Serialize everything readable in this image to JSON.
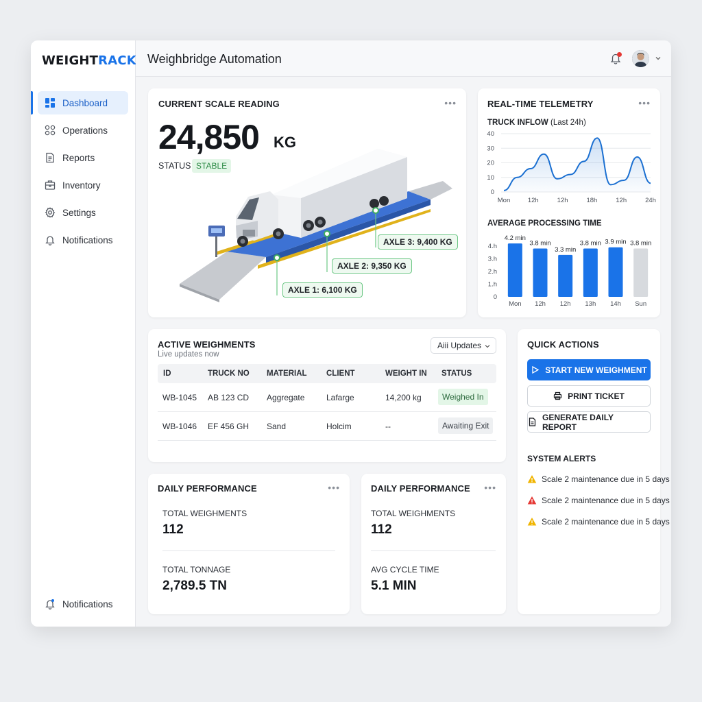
{
  "brand": {
    "part1": "WEIGHT",
    "part2": "RACK"
  },
  "header": {
    "title": "Weighbridge Automation"
  },
  "sidebar": {
    "items": [
      {
        "label": "Dashboard",
        "icon": "dashboard-icon",
        "active": true
      },
      {
        "label": "Operations",
        "icon": "operations-icon"
      },
      {
        "label": "Reports",
        "icon": "reports-icon"
      },
      {
        "label": "Inventory",
        "icon": "inventory-icon"
      },
      {
        "label": "Settings",
        "icon": "gear-icon"
      },
      {
        "label": "Notifications",
        "icon": "bell-icon"
      }
    ],
    "bottom": {
      "label": "Notifications"
    }
  },
  "scale": {
    "title": "CURRENT SCALE READING",
    "weight": "24,850",
    "unit": "KG",
    "status_label": "STATUS",
    "status": "STABLE",
    "axles": [
      "AXLE 1: 6,100 KG",
      "AXLE 2: 9,350 KG",
      "AXLE 3: 9,400 KG"
    ]
  },
  "telemetry": {
    "title": "REAL-TIME TELEMETRY",
    "inflow_title": "TRUCK INFLOW",
    "inflow_sub": "(Last 24h)",
    "processing_title": "AVERAGE PROCESSING TIME"
  },
  "chart_data": [
    {
      "type": "line",
      "title": "TRUCK INFLOW (Last 24h)",
      "x_labels": [
        "Mon",
        "12h",
        "12h",
        "18h",
        "12h",
        "24h"
      ],
      "y_ticks": [
        0,
        10,
        20,
        30,
        40
      ],
      "ylim": [
        0,
        40
      ],
      "values": [
        1,
        10,
        16,
        26,
        9,
        12,
        21,
        37,
        5,
        8,
        24,
        6
      ],
      "grid": true,
      "color": "#1a6fd1"
    },
    {
      "type": "bar",
      "title": "AVERAGE PROCESSING TIME",
      "categories": [
        "Mon",
        "12h",
        "12h",
        "13h",
        "14h",
        "Sun"
      ],
      "values": [
        4.2,
        3.8,
        3.3,
        3.8,
        3.9,
        3.8
      ],
      "data_labels": [
        "4.2 min",
        "3.8 min",
        "3.3 min",
        "3.8 min",
        "3.9 min",
        "3.8 min"
      ],
      "y_ticks": [
        "0",
        "1.h",
        "2.h",
        "3.h",
        "4.h"
      ],
      "ylim": [
        0,
        4.8
      ],
      "colors": [
        "#1a73e8",
        "#1a73e8",
        "#1a73e8",
        "#1a73e8",
        "#1a73e8",
        "#d7dade"
      ]
    }
  ],
  "weighments": {
    "title": "ACTIVE WEIGHMENTS",
    "subtitle": "Live updates now",
    "dropdown": "Aiii Updates",
    "columns": [
      "ID",
      "TRUCK NO",
      "MATERIAL",
      "CLIENT",
      "WEIGHT IN",
      "STATUS"
    ],
    "rows": [
      {
        "id": "WB-1045",
        "truck": "AB 123 CD",
        "material": "Aggregate",
        "client": "Lafarge",
        "weight": "14,200 kg",
        "status": "Weighed In"
      },
      {
        "id": "WB-1046",
        "truck": "EF 456 GH",
        "material": "Sand",
        "client": "Holcim",
        "weight": "--",
        "status": "Awaiting Exit"
      }
    ]
  },
  "quick_actions": {
    "title": "QUICK ACTIONS",
    "start": "START NEW WEIGHMENT",
    "print": "PRINT TICKET",
    "report": "GENERATE DAILY REPORT"
  },
  "alerts": {
    "title": "SYSTEM ALERTS",
    "items": [
      {
        "text": "Scale 2 maintenance due in 5 days",
        "color": "#f0b400"
      },
      {
        "text": "Scale 2 maintenance due in 5 days",
        "color": "#e53935"
      },
      {
        "text": "Scale 2 maintenance due in 5 days",
        "color": "#f0b400"
      }
    ]
  },
  "perf1": {
    "title": "DAILY PERFORMANCE",
    "label1": "TOTAL WEIGHMENTS",
    "value1": "112",
    "label2": "TOTAL TONNAGE",
    "value2": "2,789.5 TN"
  },
  "perf2": {
    "title": "DAILY PERFORMANCE",
    "label1": "TOTAL WEIGHMENTS",
    "value1": "112",
    "label2": "AVG CYCLE TIME",
    "value2": "5.1 MIN"
  },
  "colors": {
    "accent": "#1a73e8",
    "success": "#2e8b47",
    "warning": "#f0b400",
    "danger": "#e53935"
  }
}
